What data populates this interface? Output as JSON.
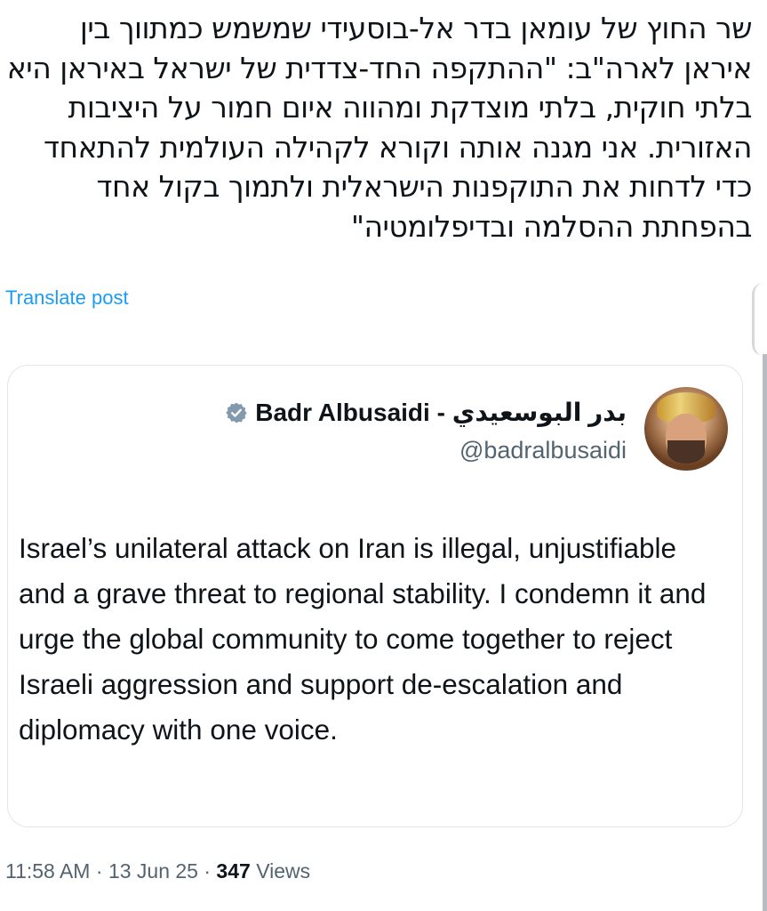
{
  "post": {
    "text_he": "שר החוץ של עומאן בדר אל-בוסעידי שמשמש כמתווך בין איראן לארה\"ב: \"ההתקפה החד-צדדית של ישראל באיראן היא בלתי חוקית, בלתי מוצדקת ומהווה איום חמור על היציבות האזורית. אני מגנה אותה וקורא לקהילה העולמית להתאחד כדי לדחות את התוקפנות הישראלית ולתמוך בקול אחד בהפחתת ההסלמה ובדיפלומטיה\"",
    "translate_label": "Translate post",
    "time": "11:58 AM",
    "date": "13 Jun 25",
    "separator": "·",
    "views_count": "347",
    "views_label": "Views"
  },
  "quoted": {
    "display_name": "Badr Albusaidi - بدر البوسعيدي",
    "handle": "@badralbusaidi",
    "text": "Israel’s unilateral attack on Iran is illegal, unjustifiable and a grave threat to regional stability. I condemn it and urge the global community to come together to reject Israeli aggression and support de-escalation and diplomacy with one voice.",
    "verified_icon": "verified-badge-icon",
    "verified_color": "#829aab"
  },
  "colors": {
    "link": "#1d9bf0",
    "text": "#0f1419",
    "secondary": "#536471",
    "border": "#e3e6e8"
  }
}
